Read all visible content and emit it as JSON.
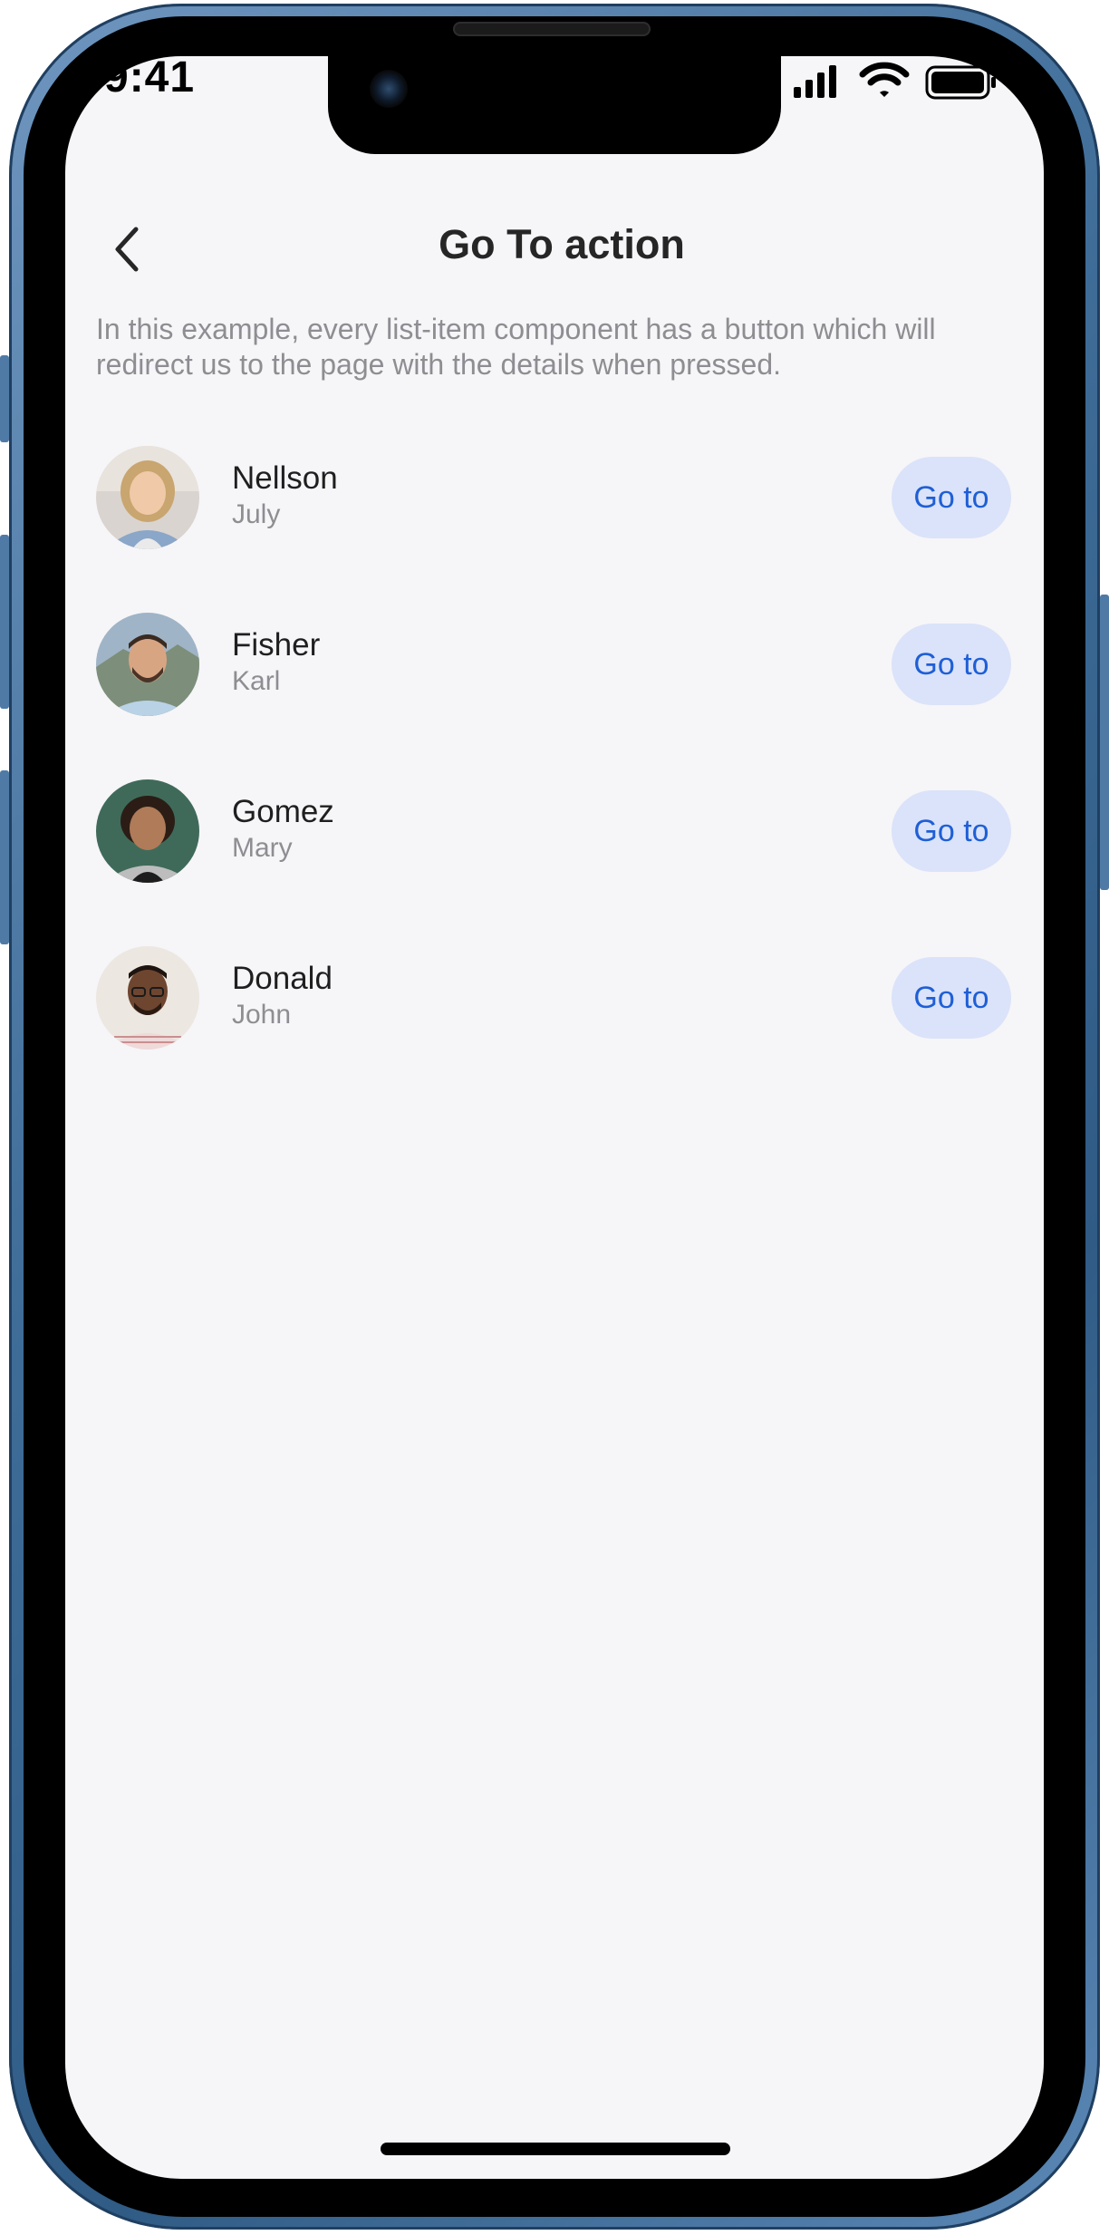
{
  "status_bar": {
    "time": "9:41"
  },
  "nav": {
    "title": "Go To action",
    "back_icon": "chevron-left-icon"
  },
  "description": "In this example, every list-item component has a button which will redirect us to the page with the details when pressed.",
  "list": [
    {
      "primary": "Nellson",
      "secondary": "July",
      "button": "Go to"
    },
    {
      "primary": "Fisher",
      "secondary": "Karl",
      "button": "Go to"
    },
    {
      "primary": "Gomez",
      "secondary": "Mary",
      "button": "Go to"
    },
    {
      "primary": "Donald",
      "secondary": "John",
      "button": "Go to"
    }
  ],
  "colors": {
    "background": "#f6f5f8",
    "button_bg": "#dae3f9",
    "button_text": "#1f5fd6",
    "secondary_text": "#8e8e92",
    "frame": "#3f6d98"
  }
}
